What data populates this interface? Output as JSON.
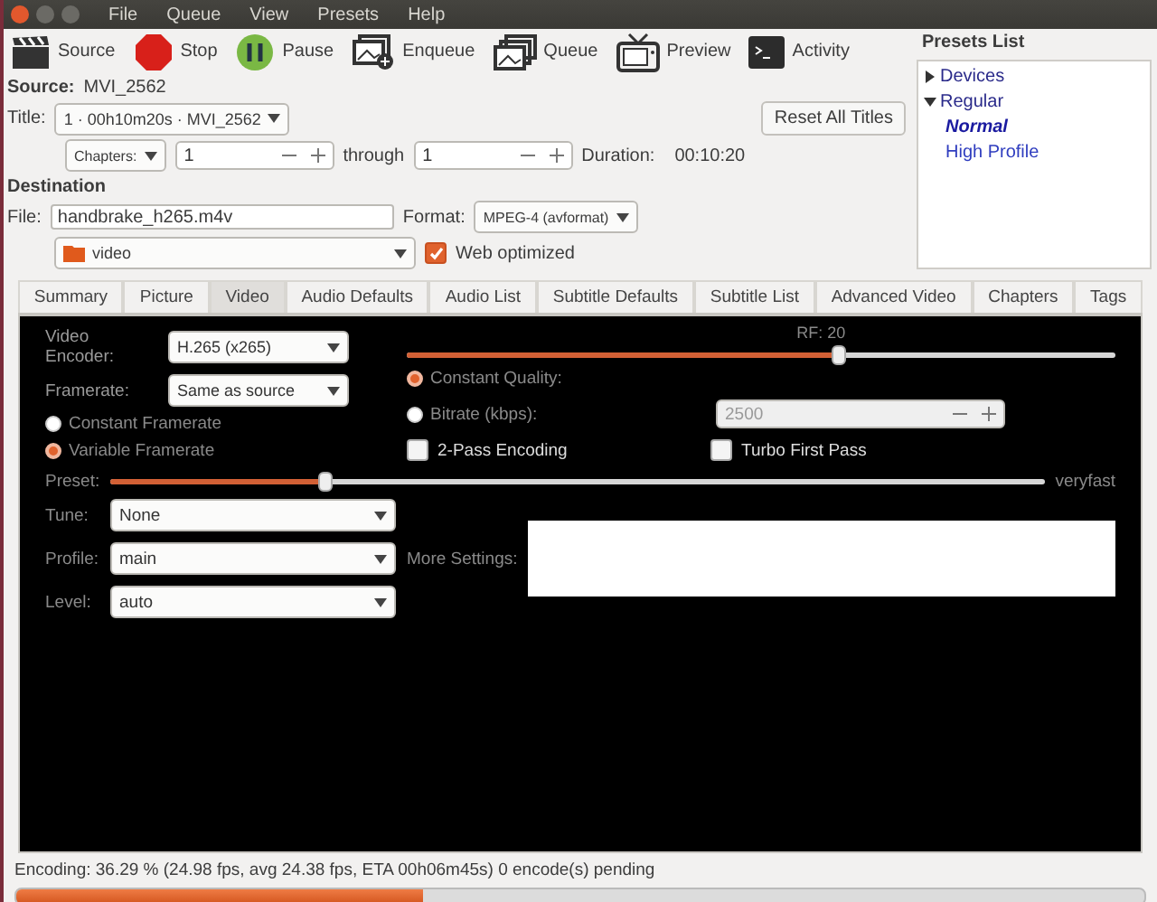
{
  "menu": [
    "File",
    "Queue",
    "View",
    "Presets",
    "Help"
  ],
  "toolbar": [
    {
      "label": "Source"
    },
    {
      "label": "Stop"
    },
    {
      "label": "Pause"
    },
    {
      "label": "Enqueue"
    },
    {
      "label": "Queue"
    },
    {
      "label": "Preview"
    },
    {
      "label": "Activity"
    }
  ],
  "source": {
    "label": "Source:",
    "value": "MVI_2562"
  },
  "title": {
    "label": "Title:",
    "value": "1 · 00h10m20s · MVI_2562",
    "reset_button": "Reset All Titles"
  },
  "range": {
    "mode": "Chapters:",
    "start": "1",
    "through": "through",
    "end": "1",
    "duration_label": "Duration:",
    "duration": "00:10:20"
  },
  "destination": {
    "heading": "Destination",
    "file_label": "File:",
    "file": "handbrake_h265.m4v",
    "folder": "video",
    "format_label": "Format:",
    "format": "MPEG-4 (avformat)",
    "web_optimized": {
      "label": "Web optimized",
      "checked": true
    }
  },
  "presets": {
    "title": "Presets List",
    "items": [
      {
        "label": "Devices",
        "expanded": false
      },
      {
        "label": "Regular",
        "expanded": true,
        "children": [
          {
            "label": "Normal",
            "selected": true
          },
          {
            "label": "High Profile",
            "selected": false
          }
        ]
      }
    ]
  },
  "tabs": [
    {
      "label": "Summary",
      "selected": false
    },
    {
      "label": "Picture",
      "selected": false
    },
    {
      "label": "Video",
      "selected": true
    },
    {
      "label": "Audio Defaults",
      "selected": false
    },
    {
      "label": "Audio List",
      "selected": false
    },
    {
      "label": "Subtitle Defaults",
      "selected": false
    },
    {
      "label": "Subtitle List",
      "selected": false
    },
    {
      "label": "Advanced Video",
      "selected": false
    },
    {
      "label": "Chapters",
      "selected": false
    },
    {
      "label": "Tags",
      "selected": false
    }
  ],
  "video": {
    "encoder": {
      "label": "Video Encoder:",
      "value": "H.265 (x265)"
    },
    "framerate": {
      "label": "Framerate:",
      "value": "Same as source"
    },
    "framerate_modes": [
      {
        "label": "Constant Framerate",
        "selected": false
      },
      {
        "label": "Variable Framerate",
        "selected": true
      }
    ],
    "rf": {
      "label": "RF: 20",
      "level": 0.61
    },
    "quality_modes": [
      {
        "label": "Constant Quality:",
        "selected": true
      },
      {
        "label": "Bitrate (kbps):",
        "selected": false
      }
    ],
    "bitrate": {
      "value": "2500",
      "disabled": true
    },
    "checkboxes": [
      {
        "label": "2-Pass Encoding",
        "checked": false
      },
      {
        "label": "Turbo First Pass",
        "checked": false
      }
    ],
    "preset": {
      "label": "Preset:",
      "level": 0.23,
      "value": "veryfast"
    },
    "selects": [
      {
        "label": "Tune:",
        "value": "None"
      },
      {
        "label": "Profile:",
        "value": "main"
      },
      {
        "label": "Level:",
        "value": "auto"
      }
    ],
    "more_settings": {
      "label": "More Settings:"
    }
  },
  "status": {
    "text": "Encoding: 36.29 % (24.98 fps, avg 24.38 fps, ETA 00h06m45s) 0 encode(s) pending",
    "level": 0.36
  }
}
